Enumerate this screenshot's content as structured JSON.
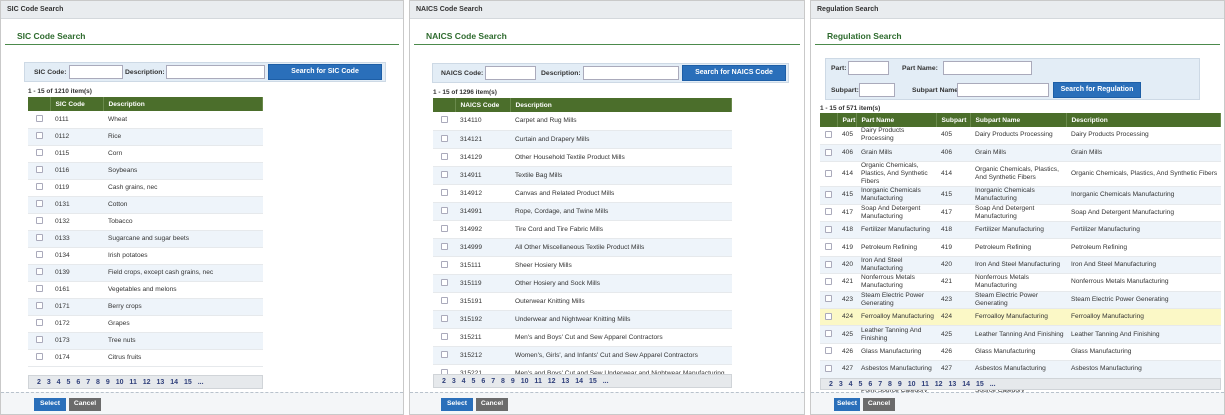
{
  "sic": {
    "window_title": "SIC Code Search",
    "heading": "SIC Code Search",
    "code_label": "SIC Code:",
    "desc_label": "Description:",
    "code_value": "",
    "desc_value": "",
    "search_button": "Search for SIC Code",
    "count": "1 - 15 of 1210 item(s)",
    "columns": [
      "SIC Code",
      "Description"
    ],
    "rows": [
      [
        "0111",
        "Wheat"
      ],
      [
        "0112",
        "Rice"
      ],
      [
        "0115",
        "Corn"
      ],
      [
        "0116",
        "Soybeans"
      ],
      [
        "0119",
        "Cash grains, nec"
      ],
      [
        "0131",
        "Cotton"
      ],
      [
        "0132",
        "Tobacco"
      ],
      [
        "0133",
        "Sugarcane and sugar beets"
      ],
      [
        "0134",
        "Irish potatoes"
      ],
      [
        "0139",
        "Field crops, except cash grains, nec"
      ],
      [
        "0161",
        "Vegetables and melons"
      ],
      [
        "0171",
        "Berry crops"
      ],
      [
        "0172",
        "Grapes"
      ],
      [
        "0173",
        "Tree nuts"
      ],
      [
        "0174",
        "Citrus fruits"
      ]
    ],
    "pager": "2 3 4 5 6 7 8 9 10 11 12 13 14 15 ...",
    "select_button": "Select",
    "cancel_button": "Cancel"
  },
  "naics": {
    "window_title": "NAICS Code Search",
    "heading": "NAICS Code Search",
    "code_label": "NAICS Code:",
    "desc_label": "Description:",
    "code_value": "",
    "desc_value": "",
    "search_button": "Search for NAICS Code",
    "count": "1 - 15 of 1296 item(s)",
    "columns": [
      "NAICS Code",
      "Description"
    ],
    "rows": [
      [
        "314110",
        "Carpet and Rug Mills"
      ],
      [
        "314121",
        "Curtain and Drapery Mills"
      ],
      [
        "314129",
        "Other Household Textile Product Mills"
      ],
      [
        "314911",
        "Textile Bag Mills"
      ],
      [
        "314912",
        "Canvas and Related Product Mills"
      ],
      [
        "314991",
        "Rope, Cordage, and Twine Mills"
      ],
      [
        "314992",
        "Tire Cord and Tire Fabric Mills"
      ],
      [
        "314999",
        "All Other Miscellaneous Textile Product Mills"
      ],
      [
        "315111",
        "Sheer Hosiery Mills"
      ],
      [
        "315119",
        "Other Hosiery and Sock Mills"
      ],
      [
        "315191",
        "Outerwear Knitting Mills"
      ],
      [
        "315192",
        "Underwear and Nightwear Knitting Mills"
      ],
      [
        "315211",
        "Men's and Boys' Cut and Sew Apparel Contractors"
      ],
      [
        "315212",
        "Women's, Girls', and Infants' Cut and Sew Apparel Contractors"
      ],
      [
        "315221",
        "Men's and Boys' Cut and Sew Underwear and Nightwear Manufacturing"
      ]
    ],
    "pager": "2 3 4 5 6 7 8 9 10 11 12 13 14 15 ...",
    "select_button": "Select",
    "cancel_button": "Cancel"
  },
  "reg": {
    "window_title": "Regulation Search",
    "heading": "Regulation Search",
    "part_label": "Part:",
    "part_name_label": "Part Name:",
    "subpart_label": "Subpart:",
    "subpart_name_label": "Subpart Name:",
    "part_value": "",
    "part_name_value": "",
    "subpart_value": "",
    "subpart_name_value": "",
    "search_button": "Search for Regulation",
    "count": "1 - 15 of 571 item(s)",
    "columns": [
      "Part",
      "Part Name",
      "Subpart",
      "Subpart Name",
      "Description"
    ],
    "rows": [
      [
        "405",
        "Dairy Products Processing",
        "405",
        "Dairy Products Processing",
        "Dairy Products Processing"
      ],
      [
        "406",
        "Grain Mills",
        "406",
        "Grain Mills",
        "Grain Mills"
      ],
      [
        "414",
        "Organic Chemicals, Plastics, And Synthetic Fibers",
        "414",
        "Organic Chemicals, Plastics, And Synthetic Fibers",
        "Organic Chemicals, Plastics, And Synthetic Fibers"
      ],
      [
        "415",
        "Inorganic Chemicals Manufacturing",
        "415",
        "Inorganic Chemicals Manufacturing",
        "Inorganic Chemicals Manufacturing"
      ],
      [
        "417",
        "Soap And Detergent Manufacturing",
        "417",
        "Soap And Detergent Manufacturing",
        "Soap And Detergent Manufacturing"
      ],
      [
        "418",
        "Fertilizer Manufacturing",
        "418",
        "Fertilizer Manufacturing",
        "Fertilizer Manufacturing"
      ],
      [
        "419",
        "Petroleum Refining",
        "419",
        "Petroleum Refining",
        "Petroleum Refining"
      ],
      [
        "420",
        "Iron And Steel Manufacturing",
        "420",
        "Iron And Steel Manufacturing",
        "Iron And Steel Manufacturing"
      ],
      [
        "421",
        "Nonferrous Metals Manufacturing",
        "421",
        "Nonferrous Metals Manufacturing",
        "Nonferrous Metals Manufacturing"
      ],
      [
        "423",
        "Steam Electric Power Generating",
        "423",
        "Steam Electric Power Generating",
        "Steam Electric Power Generating"
      ],
      [
        "424",
        "Ferroalloy Manufacturing",
        "424",
        "Ferroalloy Manufacturing",
        "Ferroalloy Manufacturing"
      ],
      [
        "425",
        "Leather Tanning And Finishing",
        "425",
        "Leather Tanning And Finishing",
        "Leather Tanning And Finishing"
      ],
      [
        "426",
        "Glass Manufacturing",
        "426",
        "Glass Manufacturing",
        "Glass Manufacturing"
      ],
      [
        "427",
        "Asbestos Manufacturing",
        "427",
        "Asbestos Manufacturing",
        "Asbestos Manufacturing"
      ],
      [
        "428",
        "Rubber Manufacturing Point Source Category",
        "428",
        "Rubber Manufacturing Point Source Category",
        "Rubber Manufacturing Point Source Category"
      ]
    ],
    "highlight_row": 10,
    "pager": "2 3 4 5 6 7 8 9 10 11 12 13 14 15 ...",
    "select_button": "Select",
    "cancel_button": "Cancel"
  },
  "colors": {
    "header_green": "#4b6e2b",
    "button_blue": "#2a6fba",
    "heading_green": "#2e6b2e",
    "highlight": "#fbf8c6"
  }
}
